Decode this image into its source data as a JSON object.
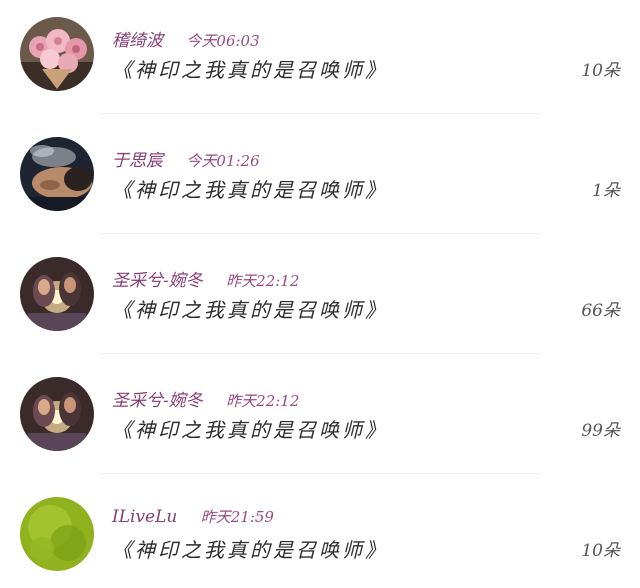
{
  "records": [
    {
      "user": "稽绮波",
      "time": "今天06:03",
      "book": "《神印之我真的是召唤师》",
      "count": "10朵",
      "avatar": "roses-bouquet"
    },
    {
      "user": "于思宸",
      "time": "今天01:26",
      "book": "《神印之我真的是召唤师》",
      "count": "1朵",
      "avatar": "smoking-man"
    },
    {
      "user": "圣采兮-婉冬",
      "time": "昨天22:12",
      "book": "《神印之我真的是召唤师》",
      "count": "66朵",
      "avatar": "couple-light"
    },
    {
      "user": "圣采兮-婉冬",
      "time": "昨天22:12",
      "book": "《神印之我真的是召唤师》",
      "count": "99朵",
      "avatar": "couple-light"
    },
    {
      "user": "ILiveLu",
      "time": "昨天21:59",
      "book": "《神印之我真的是召唤师》",
      "count": "10朵",
      "avatar": "green-blur"
    }
  ]
}
